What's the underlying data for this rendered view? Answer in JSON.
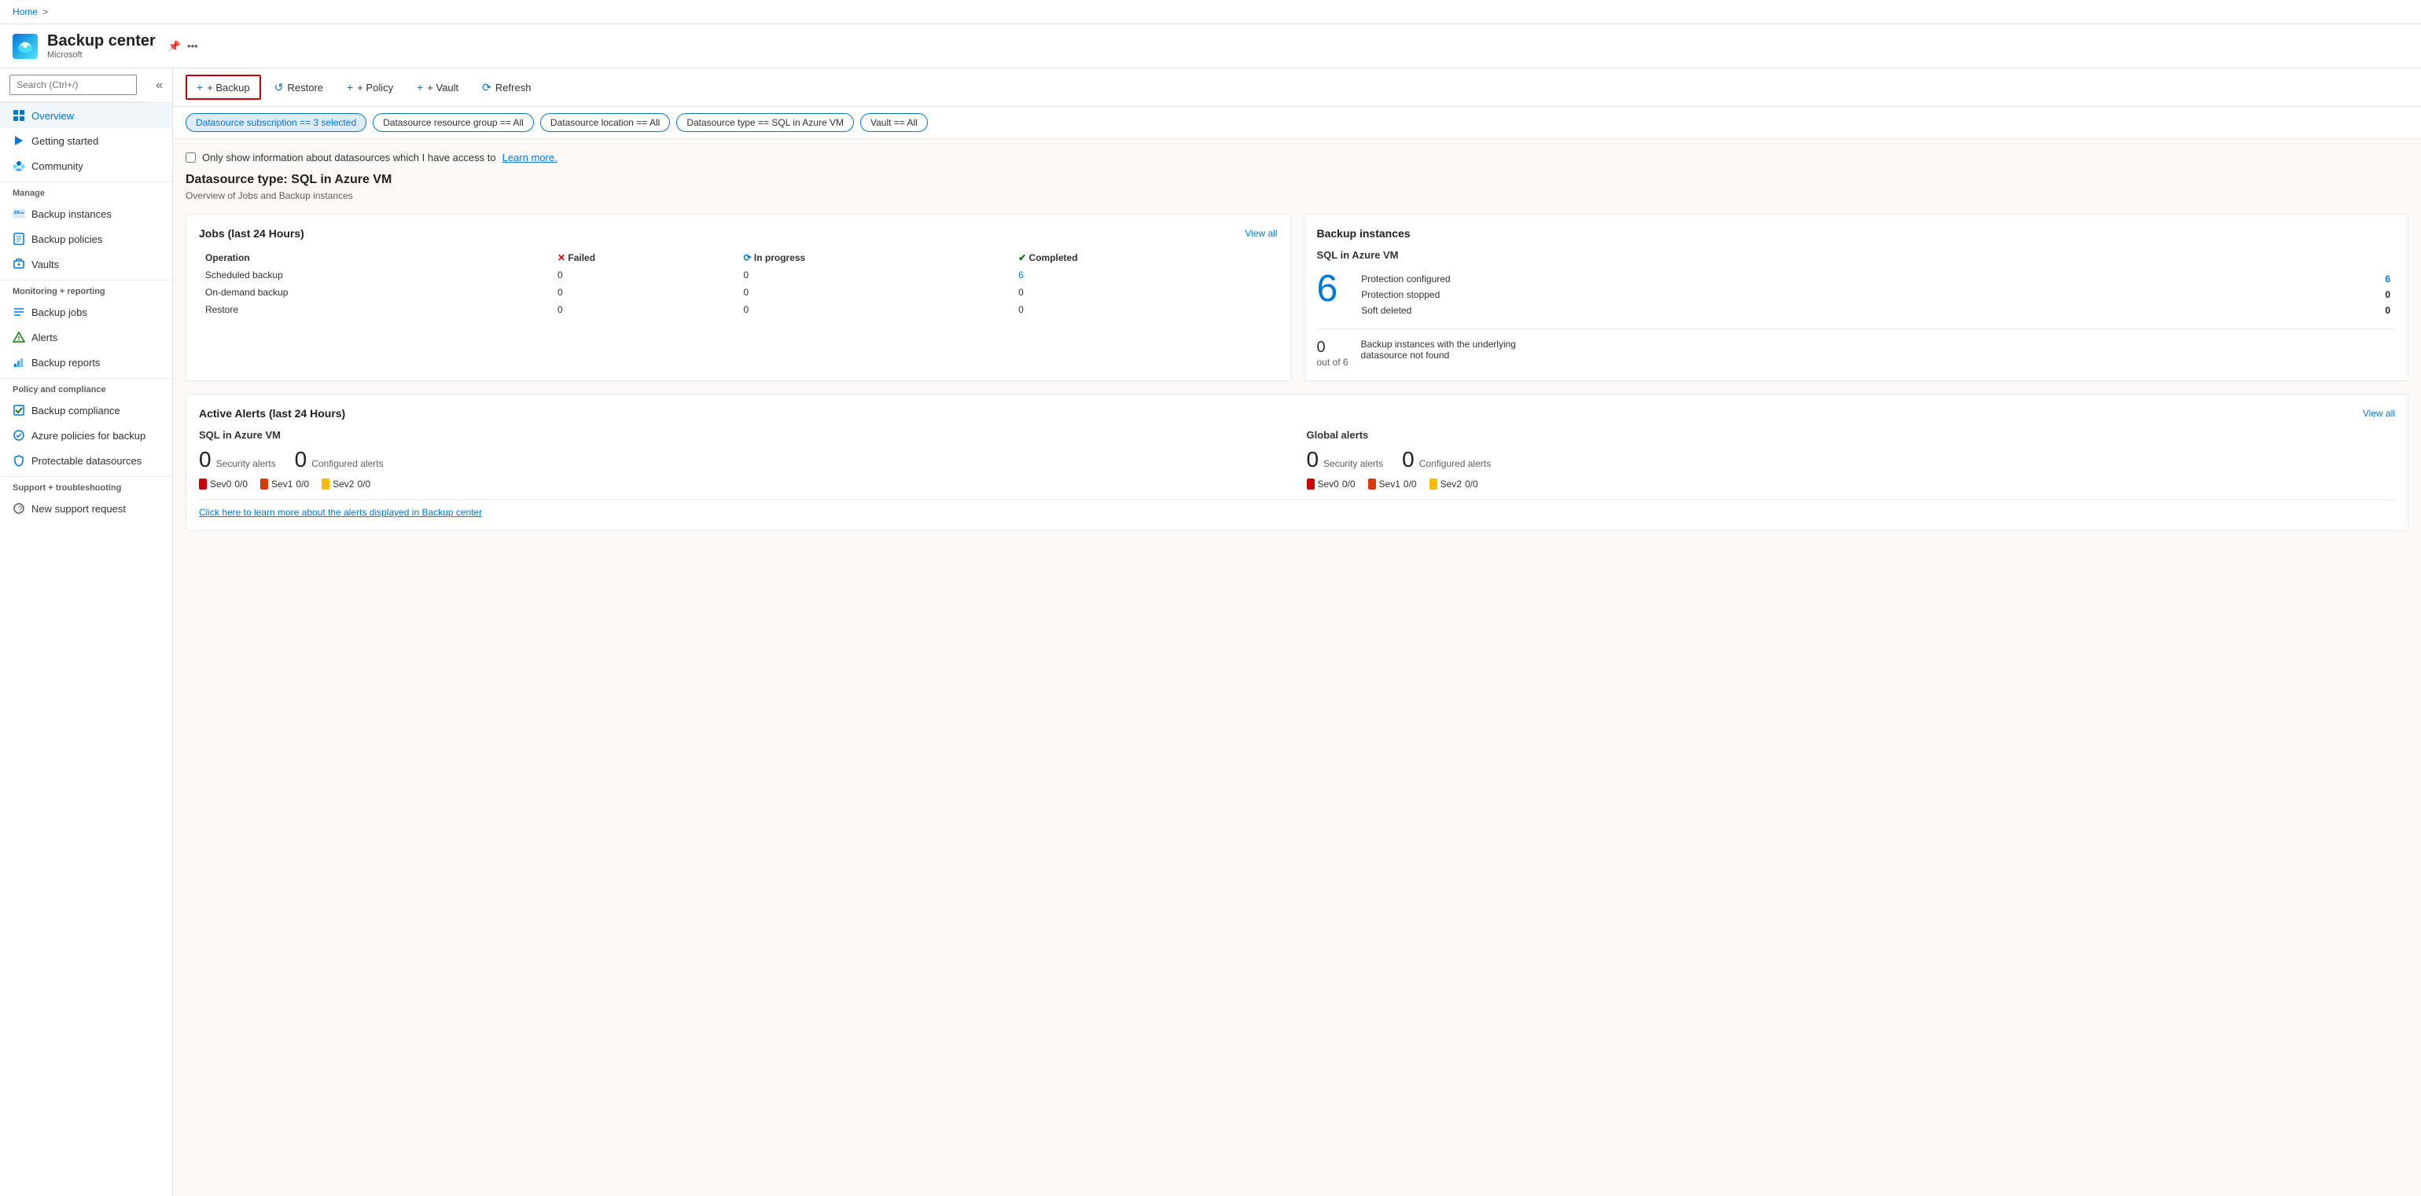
{
  "breadcrumb": {
    "home": "Home",
    "separator": ">"
  },
  "app": {
    "title": "Backup center",
    "subtitle": "Microsoft"
  },
  "toolbar": {
    "backup_label": "+ Backup",
    "restore_label": "Restore",
    "policy_label": "+ Policy",
    "vault_label": "+ Vault",
    "refresh_label": "Refresh"
  },
  "filters": [
    {
      "id": "subscription",
      "label": "Datasource subscription == 3 selected",
      "active": true
    },
    {
      "id": "resource_group",
      "label": "Datasource resource group == All",
      "active": false
    },
    {
      "id": "location",
      "label": "Datasource location == All",
      "active": false
    },
    {
      "id": "type",
      "label": "Datasource type == SQL in Azure VM",
      "active": false
    },
    {
      "id": "vault",
      "label": "Vault == All",
      "active": false
    }
  ],
  "access_checkbox": {
    "label": "Only show information about datasources which I have access to",
    "link_text": "Learn more."
  },
  "section": {
    "title": "Datasource type: SQL in Azure VM",
    "subtitle": "Overview of Jobs and Backup instances"
  },
  "jobs_card": {
    "title": "Jobs (last 24 Hours)",
    "view_all": "View all",
    "headers": {
      "operation": "Operation",
      "failed": "Failed",
      "in_progress": "In progress",
      "completed": "Completed"
    },
    "rows": [
      {
        "operation": "Scheduled backup",
        "failed": "0",
        "in_progress": "0",
        "completed": "6"
      },
      {
        "operation": "On-demand backup",
        "failed": "0",
        "in_progress": "0",
        "completed": "0"
      },
      {
        "operation": "Restore",
        "failed": "0",
        "in_progress": "0",
        "completed": "0"
      }
    ]
  },
  "backup_instances_card": {
    "title": "Backup instances",
    "subtitle": "SQL in Azure VM",
    "total_number": "6",
    "protection_configured_label": "Protection configured",
    "protection_configured_value": "6",
    "protection_stopped_label": "Protection stopped",
    "protection_stopped_value": "0",
    "soft_deleted_label": "Soft deleted",
    "soft_deleted_value": "0",
    "bottom_count": "0",
    "bottom_out_of": "out of 6",
    "bottom_label": "Backup instances with the underlying datasource not found"
  },
  "alerts_card": {
    "title": "Active Alerts (last 24 Hours)",
    "view_all": "View all",
    "sql_section": {
      "title": "SQL in Azure VM",
      "security_count": "0",
      "security_label": "Security alerts",
      "configured_count": "0",
      "configured_label": "Configured alerts",
      "sevs": [
        {
          "label": "Sev0",
          "value": "0/0"
        },
        {
          "label": "Sev1",
          "value": "0/0"
        },
        {
          "label": "Sev2",
          "value": "0/0"
        }
      ]
    },
    "global_section": {
      "title": "Global alerts",
      "security_count": "0",
      "security_label": "Security alerts",
      "configured_count": "0",
      "configured_label": "Configured alerts",
      "sevs": [
        {
          "label": "Sev0",
          "value": "0/0"
        },
        {
          "label": "Sev1",
          "value": "0/0"
        },
        {
          "label": "Sev2",
          "value": "0/0"
        }
      ]
    },
    "footer_link": "Click here to learn more about the alerts displayed in Backup center"
  },
  "sidebar": {
    "search_placeholder": "Search (Ctrl+/)",
    "items": [
      {
        "id": "overview",
        "label": "Overview",
        "active": true,
        "section": ""
      },
      {
        "id": "getting-started",
        "label": "Getting started",
        "active": false,
        "section": ""
      },
      {
        "id": "community",
        "label": "Community",
        "active": false,
        "section": ""
      },
      {
        "id": "backup-instances",
        "label": "Backup instances",
        "active": false,
        "section": "Manage"
      },
      {
        "id": "backup-policies",
        "label": "Backup policies",
        "active": false,
        "section": ""
      },
      {
        "id": "vaults",
        "label": "Vaults",
        "active": false,
        "section": ""
      },
      {
        "id": "backup-jobs",
        "label": "Backup jobs",
        "active": false,
        "section": "Monitoring + reporting"
      },
      {
        "id": "alerts",
        "label": "Alerts",
        "active": false,
        "section": ""
      },
      {
        "id": "backup-reports",
        "label": "Backup reports",
        "active": false,
        "section": ""
      },
      {
        "id": "backup-compliance",
        "label": "Backup compliance",
        "active": false,
        "section": "Policy and compliance"
      },
      {
        "id": "azure-policies",
        "label": "Azure policies for backup",
        "active": false,
        "section": ""
      },
      {
        "id": "protectable-datasources",
        "label": "Protectable datasources",
        "active": false,
        "section": ""
      },
      {
        "id": "new-support",
        "label": "New support request",
        "active": false,
        "section": "Support + troubleshooting"
      }
    ]
  }
}
